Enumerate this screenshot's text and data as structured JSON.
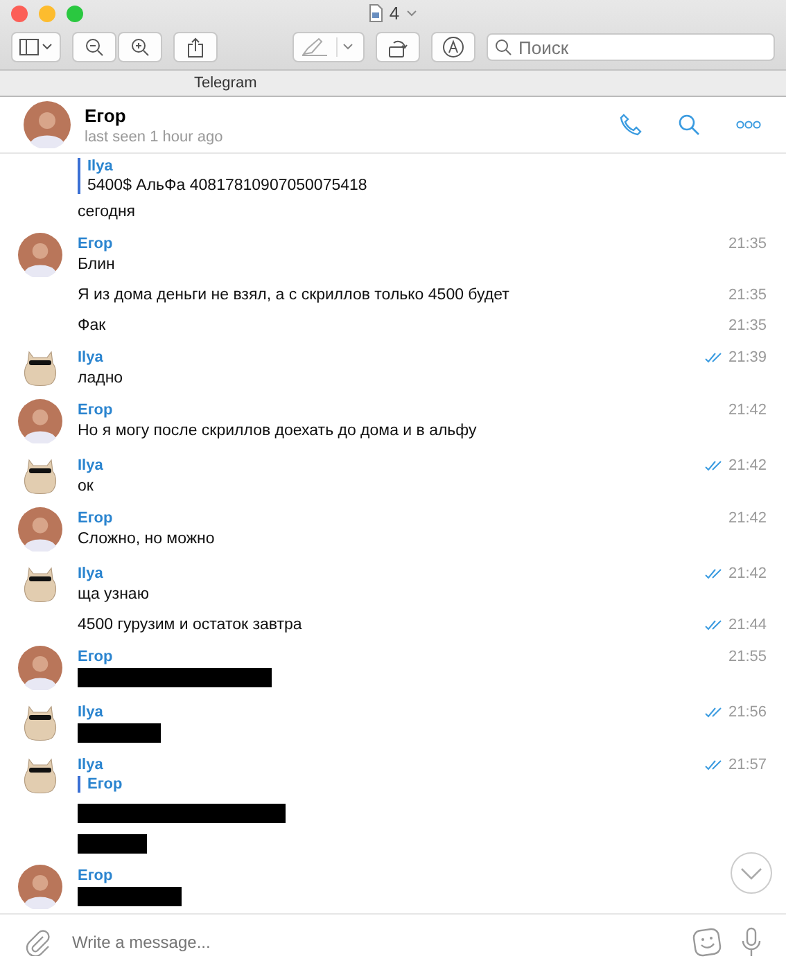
{
  "window": {
    "title": "4",
    "tab": "Telegram"
  },
  "search": {
    "placeholder": "Поиск"
  },
  "chat": {
    "name": "Егор",
    "status": "last seen 1 hour ago"
  },
  "messages": [
    {
      "reply": {
        "name": "Ilya",
        "text": "5400$ АльФа 40817810907050075418"
      },
      "lines": [
        {
          "kind": "text",
          "text": "сегодня"
        }
      ]
    },
    {
      "kind": "photo",
      "sender": "Егор",
      "time": "21:35",
      "lines": [
        {
          "kind": "text",
          "text": "Блин"
        },
        {
          "kind": "text",
          "text": "Я из дома деньги не взял, а с скриллов только 4500 будет",
          "time": "21:35"
        },
        {
          "kind": "text",
          "text": "Фак",
          "time": "21:35"
        }
      ]
    },
    {
      "kind": "sticker",
      "sender": "Ilya",
      "time": "21:39",
      "read": true,
      "lines": [
        {
          "kind": "text",
          "text": "ладно"
        }
      ]
    },
    {
      "kind": "photo",
      "sender": "Егор",
      "time": "21:42",
      "lines": [
        {
          "kind": "text",
          "text": "Но я могу  после скриллов доехать до дома и в альфу"
        }
      ]
    },
    {
      "kind": "sticker",
      "sender": "Ilya",
      "time": "21:42",
      "read": true,
      "lines": [
        {
          "kind": "text",
          "text": "ок"
        }
      ]
    },
    {
      "kind": "photo",
      "sender": "Егор",
      "time": "21:42",
      "lines": [
        {
          "kind": "text",
          "text": "Сложно, но можно"
        }
      ]
    },
    {
      "kind": "sticker",
      "sender": "Ilya",
      "time": "21:42",
      "read": true,
      "lines": [
        {
          "kind": "text",
          "text": "ща узнаю"
        },
        {
          "kind": "text",
          "text": "4500 гурузим и остаток завтра",
          "time": "21:44",
          "read": true
        }
      ]
    },
    {
      "kind": "photo",
      "sender": "Егор",
      "time": "21:55",
      "lines": [
        {
          "kind": "redacted"
        }
      ]
    },
    {
      "kind": "sticker",
      "sender": "Ilya",
      "time": "21:56",
      "read": true,
      "lines": [
        {
          "kind": "redacted"
        }
      ]
    },
    {
      "kind": "sticker",
      "sender": "Ilya",
      "time": "21:57",
      "read": true,
      "reply": {
        "name": "Егор"
      },
      "lines": [
        {
          "kind": "redacted"
        },
        {
          "kind": "redacted"
        }
      ]
    },
    {
      "kind": "photo",
      "sender": "Егор",
      "lines": [
        {
          "kind": "redacted"
        }
      ]
    }
  ],
  "composer": {
    "placeholder": "Write a message..."
  }
}
